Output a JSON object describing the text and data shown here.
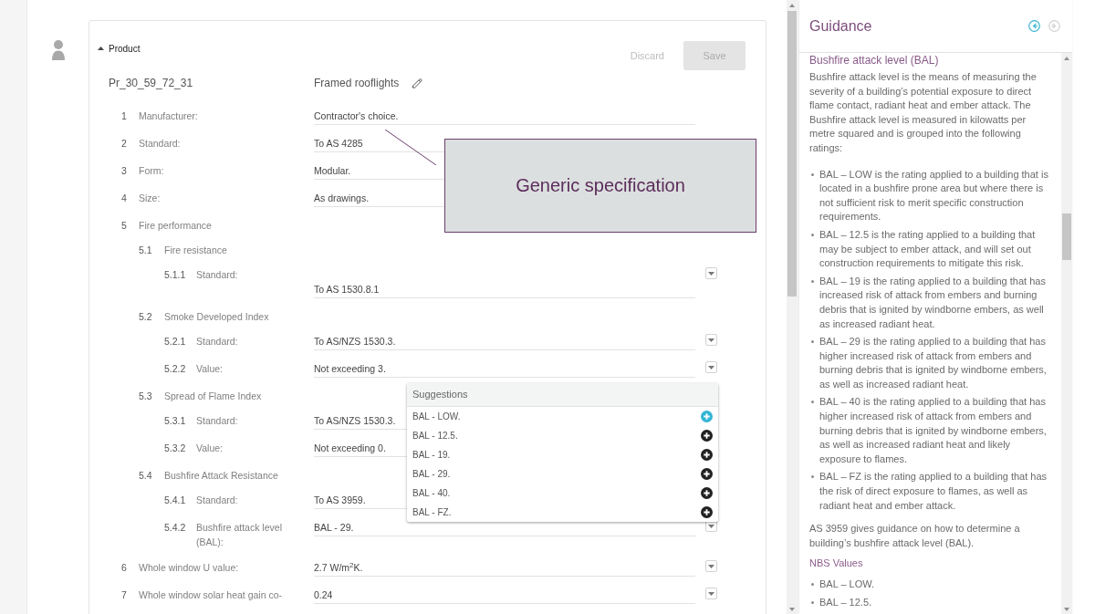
{
  "section": {
    "title": "Product",
    "expanded": true
  },
  "actions": [
    {
      "kind": "link",
      "label": "Discard",
      "disabled": true
    },
    {
      "kind": "button",
      "label": "Save",
      "disabled": true
    }
  ],
  "product": {
    "code": "Pr_30_59_72_31",
    "name": "Framed rooflights"
  },
  "clauses": [
    {
      "number": "1",
      "label": "Manufacturer:",
      "kind": "field",
      "value": "Contractor's choice.",
      "dropdown": false
    },
    {
      "number": "2",
      "label": "Standard:",
      "kind": "field",
      "value": "To AS 4285",
      "dropdown": false
    },
    {
      "number": "3",
      "label": "Form:",
      "kind": "field",
      "value": "Modular.",
      "dropdown": false
    },
    {
      "number": "4",
      "label": "Size:",
      "kind": "field",
      "value": "As drawings.",
      "dropdown": false
    },
    {
      "number": "5",
      "label": "Fire performance",
      "kind": "heading",
      "children": [
        {
          "number": "5.1",
          "label": "Fire resistance",
          "kind": "heading",
          "children": [
            {
              "number": "5.1.1",
              "label": "Standard:",
              "kind": "textarea",
              "value": "To AS 1530.8.1",
              "dropdown": true
            }
          ]
        },
        {
          "number": "5.2",
          "label": "Smoke Developed Index",
          "kind": "heading",
          "children": [
            {
              "number": "5.2.1",
              "label": "Standard:",
              "kind": "field",
              "value": "To AS/NZS 1530.3.",
              "dropdown": true
            },
            {
              "number": "5.2.2",
              "label": "Value:",
              "kind": "field",
              "value": "Not exceeding 3.",
              "dropdown": true
            }
          ]
        },
        {
          "number": "5.3",
          "label": "Spread of Flame Index",
          "kind": "heading",
          "children": [
            {
              "number": "5.3.1",
              "label": "Standard:",
              "kind": "field",
              "value": "To AS/NZS 1530.3.",
              "dropdown": false
            },
            {
              "number": "5.3.2",
              "label": "Value:",
              "kind": "field",
              "value": "Not exceeding 0.",
              "dropdown": false
            }
          ]
        },
        {
          "number": "5.4",
          "label": "Bushfire Attack Resistance",
          "kind": "heading",
          "children": [
            {
              "number": "5.4.1",
              "label": "Standard:",
              "kind": "field",
              "value": "To AS 3959.",
              "dropdown": false
            },
            {
              "number": "5.4.2",
              "label": "Bushfire attack level (BAL):",
              "kind": "field",
              "value": "BAL - 29.",
              "dropdown": true
            }
          ]
        }
      ]
    },
    {
      "number": "6",
      "label": "Whole window U value:",
      "kind": "field",
      "value": "2.7 W/m$^{2}$K.",
      "dropdown": true
    },
    {
      "number": "7",
      "label": "Whole window solar heat gain co-",
      "kind": "field",
      "value": "0.24",
      "dropdown": true
    }
  ],
  "annotation": {
    "text": "Generic specification"
  },
  "suggestions": {
    "title": "Suggestions",
    "items": [
      {
        "label": "BAL - LOW.",
        "selected": true
      },
      {
        "label": "BAL - 12.5.",
        "selected": false
      },
      {
        "label": "BAL - 19.",
        "selected": false
      },
      {
        "label": "BAL - 29.",
        "selected": false
      },
      {
        "label": "BAL - 40.",
        "selected": false
      },
      {
        "label": "BAL - FZ.",
        "selected": false
      }
    ]
  },
  "guidance": {
    "title": "Guidance",
    "navigation": [
      {
        "kind": "back",
        "disabled": false
      },
      {
        "kind": "forward",
        "disabled": true
      }
    ],
    "heading": "Bushfire attack level (BAL)",
    "blocks": [
      {
        "kind": "paragraph",
        "text": "Bushfire attack level is the means of measuring the severity of a building’s potential exposure to direct flame contact, radiant heat and ember attack. The Bushfire attack level is measured in kilowatts per metre squared and is grouped into the following ratings:"
      },
      {
        "kind": "list",
        "items": [
          "BAL – LOW is the rating applied to a building that is located in a bushfire prone area but where there is not sufficient risk to merit specific construction requirements.",
          "BAL – 12.5 is the rating applied to a building that may be subject to ember attack, and will set out construction requirements to mitigate this risk.",
          "BAL – 19 is the rating applied to a building that has increased risk of attack from embers and burning debris that is ignited by windborne embers, as well as increased radiant heat.",
          "BAL – 29 is the rating applied to a building that has higher increased risk of attack from embers and burning debris that is ignited by windborne embers, as well as increased radiant heat.",
          "BAL – 40 is the rating applied to a building that has higher increased risk of attack from embers and burning debris that is ignited by windborne embers, as well as increased radiant heat and likely exposure to flames.",
          "BAL – FZ is the rating applied to a building that has the risk of direct exposure to flames, as well as radiant heat and ember attack."
        ]
      },
      {
        "kind": "paragraph",
        "text": "AS 3959 gives guidance on how to determine a building’s bushfire attack level (BAL)."
      },
      {
        "kind": "subheading",
        "text": "NBS Values"
      },
      {
        "kind": "list",
        "items": [
          "BAL – LOW.",
          "BAL – 12.5."
        ]
      }
    ]
  }
}
